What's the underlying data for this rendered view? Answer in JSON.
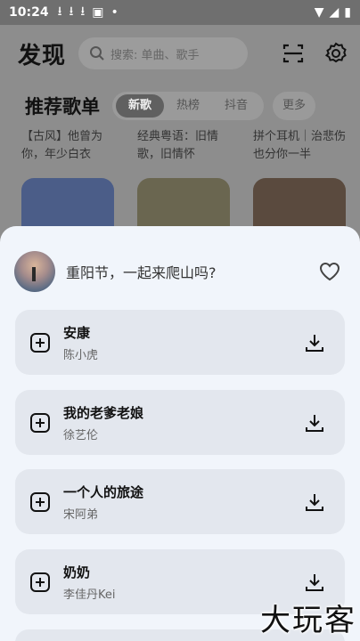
{
  "status_bar": {
    "time": "10:24"
  },
  "header": {
    "title": "发现",
    "search_placeholder": "搜索: 单曲、歌手"
  },
  "section": {
    "title": "推荐歌单",
    "tabs": [
      {
        "label": "新歌",
        "active": true
      },
      {
        "label": "热榜",
        "active": false
      },
      {
        "label": "抖音",
        "active": false
      }
    ],
    "more_label": "更多"
  },
  "cards": [
    {
      "text": "【古风】他曾为你，年少白衣",
      "color": "#4b5d88"
    },
    {
      "text": "经典粤语：旧情歌，旧情怀",
      "color": "#6a6650"
    },
    {
      "text": "拼个耳机｜治悲伤也分你一半",
      "color": "#5a4a3e"
    }
  ],
  "sheet": {
    "title": "重阳节，一起来爬山吗?",
    "songs": [
      {
        "name": "安康",
        "artist": "陈小虎"
      },
      {
        "name": "我的老爹老娘",
        "artist": "徐艺伦"
      },
      {
        "name": "一个人的旅途",
        "artist": "宋阿弟"
      },
      {
        "name": "奶奶",
        "artist": "李佳丹Kei"
      }
    ]
  },
  "watermark": "大玩客"
}
